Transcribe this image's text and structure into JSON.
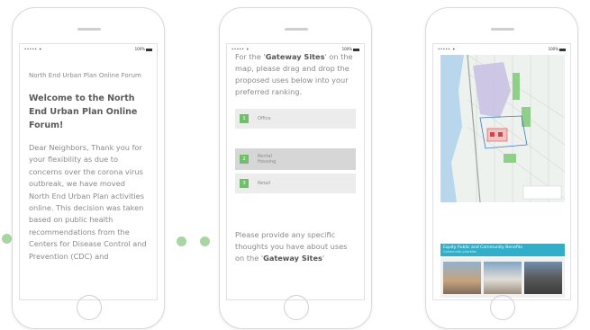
{
  "phone1": {
    "status_left": "••••• ✦",
    "status_right": "100%",
    "breadcrumb": "North End Urban Plan Online Forum",
    "heading": "Welcome to the North End Urban Plan Online Forum!",
    "body": "Dear Neighbors, Thank you for your flexibility as due to concerns over the corona virus outbreak, we have moved North End Urban Plan activities online. This decision was taken based on public health recommendations from the Centers for Disease Control and Prevention (CDC) and"
  },
  "phone2": {
    "status_left": "••••• ✦",
    "status_right": "100%",
    "prompt_before": "For the '",
    "prompt_em": "Gateway Sites",
    "prompt_after": "' on the map, please drag and drop the proposed uses below into your preferred ranking.",
    "items": [
      {
        "num": "1",
        "label": "Office"
      },
      {
        "num": "2",
        "label": "Rental Housing"
      },
      {
        "num": "3",
        "label": "Retail"
      }
    ],
    "prompt2_before": "Please provide any specific thoughts you have about uses on the '",
    "prompt2_em": "Gateway Sites",
    "prompt2_after": "'"
  },
  "phone3": {
    "status_left": "••••• ✦",
    "status_right": "100%",
    "banner_title": "Equity  Public and Community Benefits",
    "banner_small": "Community priorities"
  },
  "colors": {
    "accent_green": "#6fbf6a",
    "banner_blue": "#33aec9",
    "dot_green": "#a9d5a4"
  }
}
